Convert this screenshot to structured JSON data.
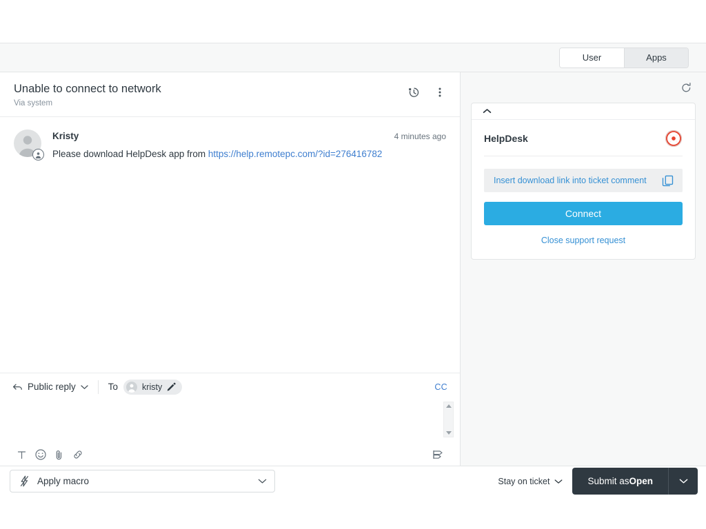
{
  "header": {
    "tabs": [
      {
        "label": "User",
        "active": false
      },
      {
        "label": "Apps",
        "active": true
      }
    ]
  },
  "ticket": {
    "title": "Unable to connect to network",
    "subtitle": "Via system",
    "history_icon": "history-clock-icon",
    "more_icon": "more-vertical-icon"
  },
  "conversation": {
    "messages": [
      {
        "author": "Kristy",
        "timestamp": "4 minutes ago",
        "text_before_link": "Please download HelpDesk app from ",
        "link_text": "https://help.remotepc.com/?id=276416782",
        "avatar_icon": "user-avatar-icon",
        "avatar_badge_icon": "end-user-badge-icon"
      }
    ]
  },
  "composer": {
    "reply_type": "Public reply",
    "reply_icon": "reply-arrow-icon",
    "chevron_icon": "chevron-down-icon",
    "to_label": "To",
    "recipient": "kristy",
    "recipient_edit_icon": "pencil-icon",
    "cc_label": "CC",
    "body_value": "",
    "body_placeholder": "",
    "tools": [
      {
        "name": "text-format-icon",
        "glyph": "T"
      },
      {
        "name": "emoji-icon",
        "glyph": "emoji"
      },
      {
        "name": "attachment-icon",
        "glyph": "paperclip"
      },
      {
        "name": "link-icon",
        "glyph": "link"
      }
    ],
    "tool_right": "markdown-icon"
  },
  "app_panel": {
    "refresh_icon": "refresh-icon",
    "collapse_icon": "chevron-up-icon",
    "app_name": "HelpDesk",
    "app_logo_icon": "lifebuoy-icon",
    "insert_link_label": "Insert download link into ticket comment",
    "copy_icon": "copy-icon",
    "connect_label": "Connect",
    "connect_color": "#2bace2",
    "close_request_label": "Close support request"
  },
  "footer": {
    "macro_label": "Apply macro",
    "macro_icon": "lightning-bolt-icon",
    "macro_chevron_icon": "chevron-down-icon",
    "stay_label": "Stay on ticket",
    "stay_chevron_icon": "chevron-down-icon",
    "submit_prefix": "Submit as ",
    "submit_status": "Open",
    "submit_caret_icon": "chevron-down-icon"
  },
  "colors": {
    "accent_blue": "#2bace2",
    "link_blue": "#3590d4",
    "message_link": "#3e7ecf",
    "dark": "#2f3941",
    "panel_bg": "#f7f8f8"
  }
}
